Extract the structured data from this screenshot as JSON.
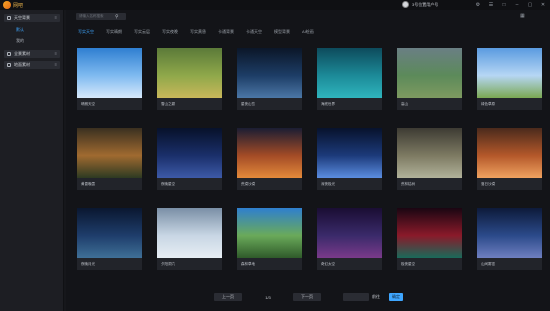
{
  "app": {
    "name": "网吧"
  },
  "user": {
    "name": "3号位置用户号"
  },
  "window_icons": [
    "⚙",
    "☰",
    "□",
    "–",
    "▢",
    "✕"
  ],
  "sidebar": {
    "groups": [
      {
        "label": "天空背景",
        "chev": "≡"
      },
      {
        "label": "全景素材",
        "chev": "≡"
      },
      {
        "label": "地面素材",
        "chev": "≡"
      }
    ],
    "subs": [
      {
        "label": "默认",
        "active": true
      },
      {
        "label": "我的",
        "active": false
      }
    ]
  },
  "search": {
    "placeholder": "请输入名称搜索"
  },
  "tabs": [
    {
      "label": "写实天空",
      "active": true
    },
    {
      "label": "写实晴朗"
    },
    {
      "label": "写实云层"
    },
    {
      "label": "写实夜晚"
    },
    {
      "label": "写实黄昏"
    },
    {
      "label": "卡通背景"
    },
    {
      "label": "卡通天空"
    },
    {
      "label": "模型背景"
    },
    {
      "label": "AI绘画"
    }
  ],
  "cards": [
    {
      "label": "晴朗天空",
      "colors": [
        "#2f7fd1",
        "#7fbaf0",
        "#d7e9fb"
      ]
    },
    {
      "label": "雪山之巅",
      "colors": [
        "#5b7a39",
        "#8fa84a",
        "#c9b75a"
      ]
    },
    {
      "label": "星夜山峦",
      "colors": [
        "#0b1628",
        "#1d3d66",
        "#4b77a6"
      ]
    },
    {
      "label": "海底世界",
      "colors": [
        "#0d4b5c",
        "#1c8a98",
        "#2fb5bd"
      ]
    },
    {
      "label": "高山",
      "colors": [
        "#6a7f84",
        "#5c8a5a",
        "#7e9a60"
      ]
    },
    {
      "label": "绿色草原",
      "colors": [
        "#5a9be0",
        "#b6d6f4",
        "#7aa852"
      ]
    },
    {
      "label": "黄昏晚霞",
      "colors": [
        "#3a3020",
        "#a06a30",
        "#2d3a22"
      ]
    },
    {
      "label": "夜晚星空",
      "colors": [
        "#07112a",
        "#1a2f6a",
        "#3d5aa8"
      ]
    },
    {
      "label": "荒漠沙漠",
      "colors": [
        "#1a1d33",
        "#a34b26",
        "#e48a3a"
      ]
    },
    {
      "label": "深夜极光",
      "colors": [
        "#07122c",
        "#1c3a7a",
        "#5b8de0"
      ]
    },
    {
      "label": "荒林枯树",
      "colors": [
        "#3d3b33",
        "#7d7a62",
        "#b1b29a"
      ]
    },
    {
      "label": "落日沙漠",
      "colors": [
        "#4a2a1c",
        "#b4582a",
        "#f0a260"
      ]
    },
    {
      "label": "夜晚月光",
      "colors": [
        "#0a1730",
        "#1e3d6b",
        "#3f7097"
      ]
    },
    {
      "label": "夕阳洞穴",
      "colors": [
        "#7a8fa6",
        "#c8d6e4",
        "#e7eef4"
      ]
    },
    {
      "label": "森林草地",
      "colors": [
        "#2f7fcf",
        "#6aaa5a",
        "#2f5a2a"
      ]
    },
    {
      "label": "奇幻太空",
      "colors": [
        "#1a0d33",
        "#3a2a6a",
        "#7a3a8a"
      ]
    },
    {
      "label": "极夜星空",
      "colors": [
        "#1a0612",
        "#8a1a2a",
        "#1a6a5a"
      ]
    },
    {
      "label": "山间雾霭",
      "colors": [
        "#0d1a3a",
        "#2b4a8a",
        "#6f7fc0"
      ]
    }
  ],
  "pager": {
    "prev": "上一页",
    "page": "1/3",
    "next": "下一页",
    "goto_label": "前往",
    "goto_btn": "确定"
  }
}
